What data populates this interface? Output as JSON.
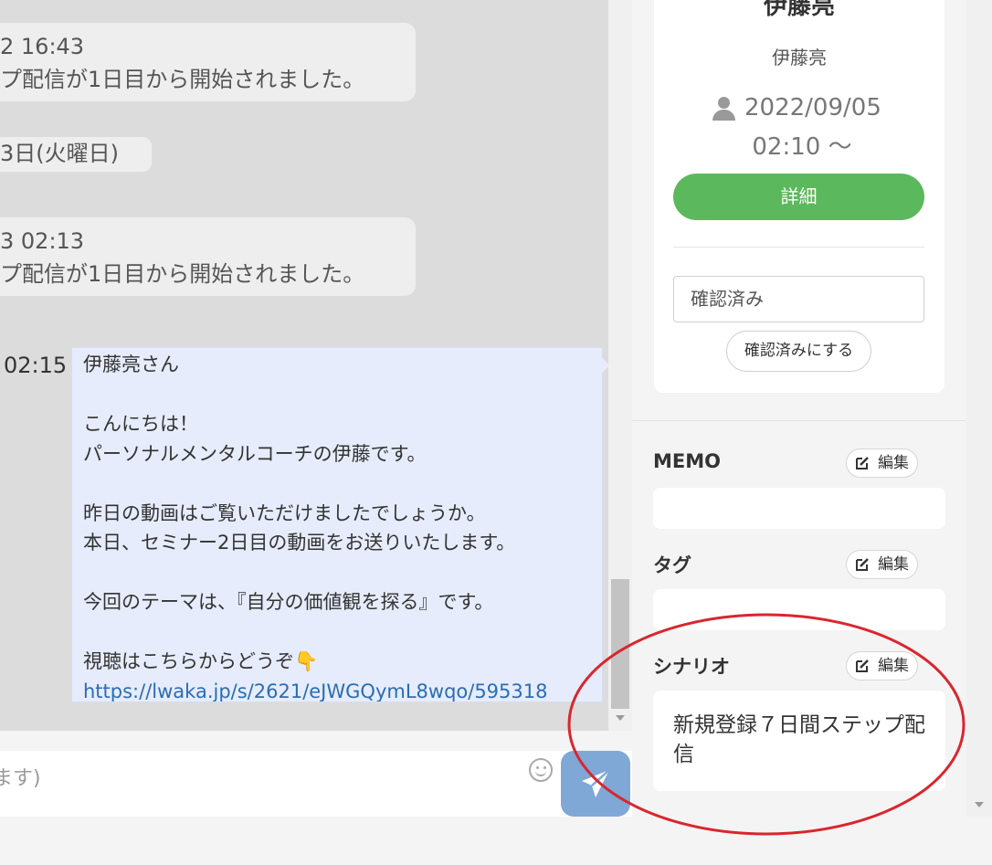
{
  "chat": {
    "messages": [
      {
        "time": "2 16:43",
        "text": "プ配信が1日目から開始されました。"
      },
      {
        "time": "3 02:13",
        "text": "プ配信が1日目から開始されました。"
      }
    ],
    "date_divider": "3日(火曜日)",
    "outgoing": {
      "time": "02:15",
      "lines": [
        "伊藤亮さん",
        "",
        "こんにちは！",
        "パーソナルメンタルコーチの伊藤です。",
        "",
        "昨日の動画はご覧いただけましたでしょうか。",
        "本日、セミナー2日目の動画をお送りいたします。",
        "",
        "今回のテーマは、『自分の価値観を探る』です。",
        "",
        "視聴はこちらからどうぞ"
      ],
      "emoji": "👇",
      "link": "https://lwaka.jp/s/2621/eJWGQymL8wqo/595318"
    },
    "composer_placeholder": "ます)"
  },
  "profile": {
    "display_name": "伊藤亮",
    "account_name": "伊藤亮",
    "registered_date": "2022/09/05",
    "registered_time": "02:10 ～",
    "detail_button": "詳細",
    "status_value": "確認済み",
    "confirm_button": "確認済みにする"
  },
  "sections": {
    "memo": {
      "title": "MEMO",
      "edit_label": "編集"
    },
    "tags": {
      "title": "タグ",
      "edit_label": "編集"
    },
    "scenario": {
      "title": "シナリオ",
      "edit_label": "編集",
      "value": "新規登録７日間ステップ配信"
    }
  },
  "colors": {
    "accent_green": "#5cb85c",
    "send_button": "#7fa8d6",
    "link": "#2a6db5",
    "highlight_circle": "#d9262e"
  },
  "icons": {
    "user": "user-icon",
    "edit": "edit-icon",
    "send": "paper-plane-icon",
    "emoji": "smiley-icon"
  }
}
